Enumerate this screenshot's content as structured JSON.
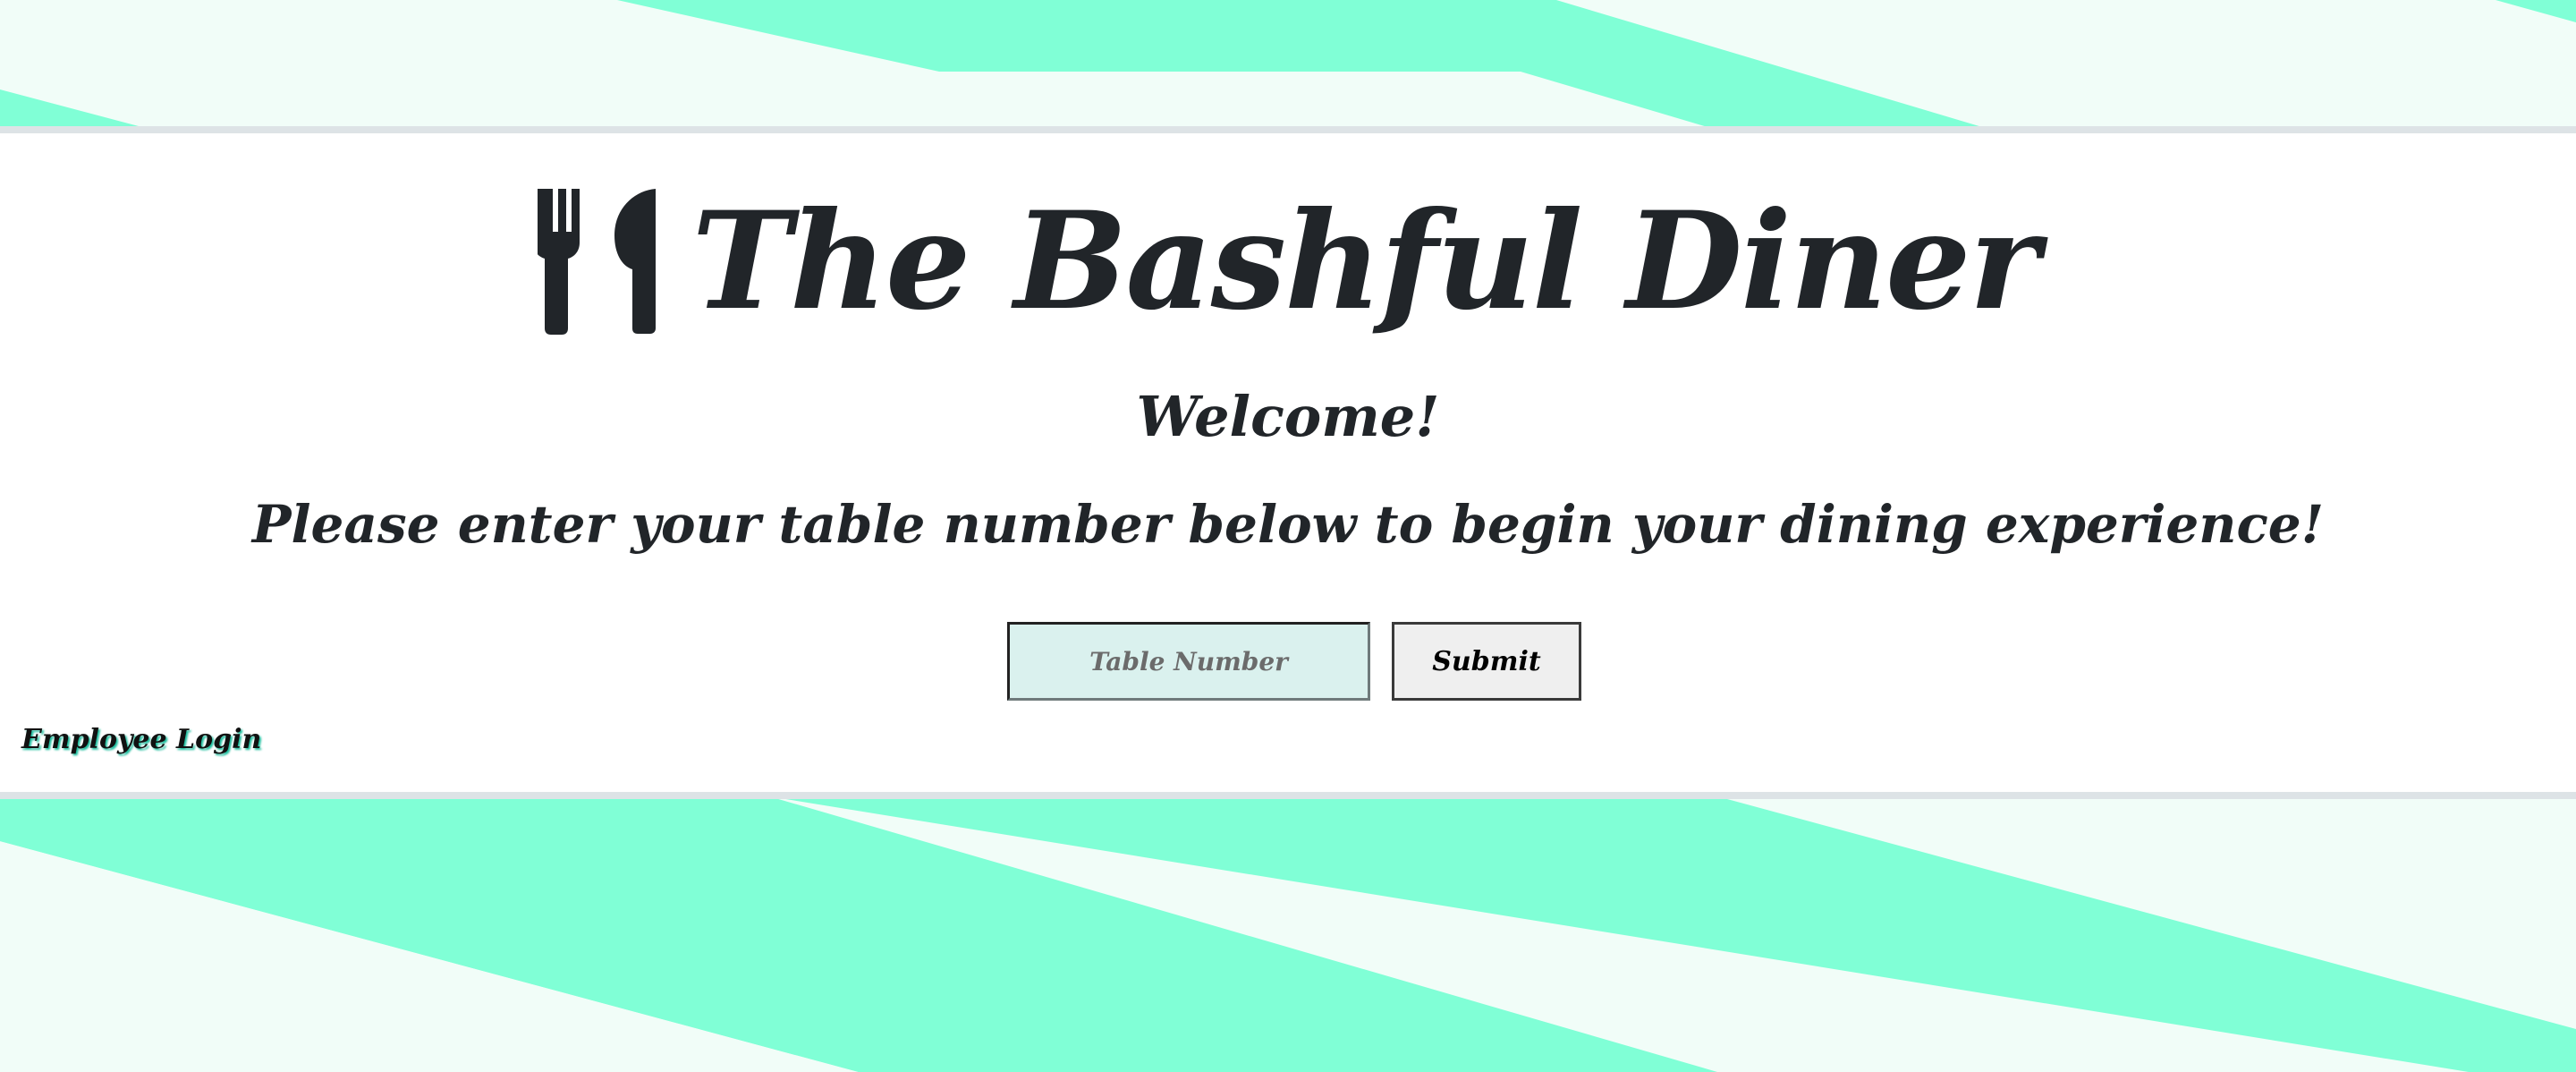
{
  "colors": {
    "stripe": "#80ffd6",
    "background": "#f1fdf8",
    "panel": "#ffffff",
    "text": "#212529",
    "input_bg": "#daf1ee",
    "button_bg": "#efefef"
  },
  "header": {
    "icon": "utensils-icon",
    "title": "The Bashful Diner"
  },
  "main": {
    "welcome": "Welcome!",
    "instructions": "Please enter your table number below to begin your dining experience!"
  },
  "form": {
    "table_placeholder": "Table Number",
    "table_value": "",
    "submit_label": "Submit"
  },
  "footer": {
    "employee_login_label": "Employee Login"
  }
}
